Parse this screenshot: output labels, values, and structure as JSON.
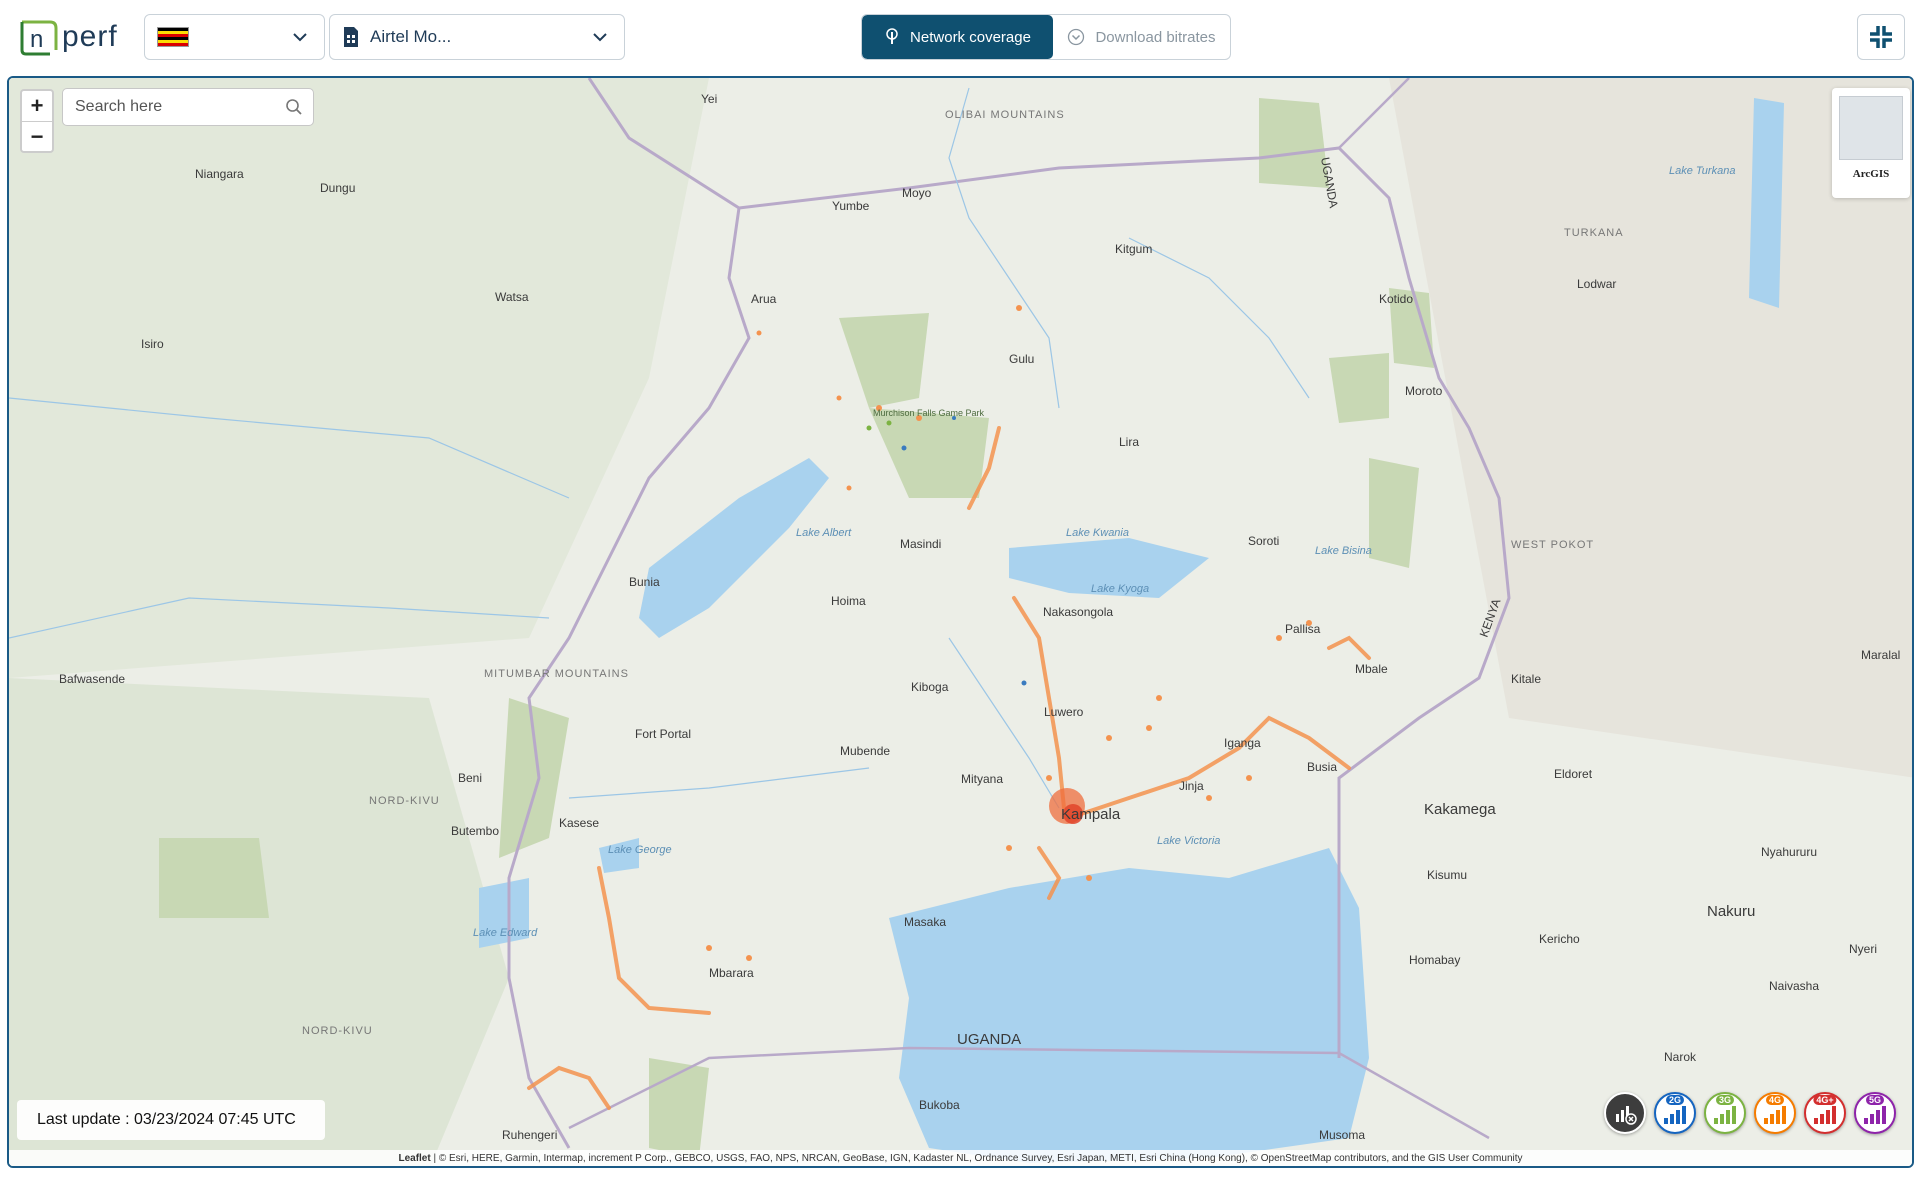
{
  "header": {
    "logo_text": "perf",
    "logo_mark": "n",
    "country_selector": {
      "flag_colors": [
        "#000000",
        "#fcdc04",
        "#d90000",
        "#000000",
        "#fcdc04",
        "#d90000"
      ]
    },
    "provider_selector": {
      "label": "Airtel Mo..."
    },
    "tabs": [
      {
        "label": "Network coverage",
        "active": true
      },
      {
        "label": "Download bitrates",
        "active": false
      }
    ]
  },
  "map": {
    "search": {
      "placeholder": "Search here"
    },
    "basemap": {
      "label": "ArcGIS"
    },
    "last_update": "Last update : 03/23/2024 07:45 UTC",
    "attribution": {
      "leaflet": "Leaflet",
      "text": " | © Esri, HERE, Garmin, Intermap, increment P Corp., GEBCO, USGS, FAO, NPS, NRCAN, GeoBase, IGN, Kadaster NL, Ordnance Survey, Esri Japan, METI, Esri China (Hong Kong), © OpenStreetMap contributors, and the GIS User Community"
    },
    "technologies": [
      {
        "label": "2G",
        "color": "#1565c0"
      },
      {
        "label": "3G",
        "color": "#7cb342"
      },
      {
        "label": "4G",
        "color": "#f57c00"
      },
      {
        "label": "4G+",
        "color": "#d32f2f"
      },
      {
        "label": "5G",
        "color": "#8e24aa"
      }
    ],
    "places": {
      "kampala": "Kampala",
      "uganda_sea": "UGANDA",
      "uganda_border": "UGANDA",
      "kenya": "KENYA",
      "kakamega": "Kakamega",
      "nakuru": "Nakuru",
      "gulu": "Gulu",
      "lira": "Lira",
      "arua": "Arua",
      "kitgum": "Kitgum",
      "moyo": "Moyo",
      "yumbe": "Yumbe",
      "masindi": "Masindi",
      "hoima": "Hoima",
      "bunia": "Bunia",
      "beni": "Beni",
      "butembo": "Butembo",
      "kasese": "Kasese",
      "fort_portal": "Fort Portal",
      "mubende": "Mubende",
      "mityana": "Mityana",
      "kiboga": "Kiboga",
      "luwero": "Luwero",
      "nakasongola": "Nakasongola",
      "jinja": "Jinja",
      "iganga": "Iganga",
      "busia": "Busia",
      "mbale": "Mbale",
      "pallisa": "Pallisa",
      "soroti": "Soroti",
      "moroto": "Moroto",
      "kotido": "Kotido",
      "lodwar": "Lodwar",
      "kitale": "Kitale",
      "eldoret": "Eldoret",
      "kisumu": "Kisumu",
      "kericho": "Kericho",
      "homabay": "Homabay",
      "masaka": "Masaka",
      "mbarara": "Mbarara",
      "bukoba": "Bukoba",
      "musoma": "Musoma",
      "narok": "Narok",
      "naivasha": "Naivasha",
      "nyahururu": "Nyahururu",
      "nyeri": "Nyeri",
      "ruhengeri": "Ruhengeri",
      "isiro": "Isiro",
      "watsa": "Watsa",
      "niangara": "Niangara",
      "dungu": "Dungu",
      "yei": "Yei",
      "bafwasende": "Bafwasende",
      "maralal": "Maralal",
      "lake_victoria": "Lake Victoria",
      "lake_kyoga": "Lake Kyoga",
      "lake_kwania": "Lake Kwania",
      "lake_albert": "Lake Albert",
      "lake_edward": "Lake Edward",
      "lake_george": "Lake George",
      "lake_turkana": "Lake Turkana",
      "lake_bisina": "Lake Bisina",
      "mitumbar": "MITUMBAR MOUNTAINS",
      "olibai": "OLIBAI MOUNTAINS",
      "turkana": "TURKANA",
      "west_pokot": "WEST POKOT",
      "nord_kivu": "NORD-KIVU",
      "nord_kivu_2": "NORD-KIVU",
      "murchison": "Murchison Falls Game Park"
    }
  }
}
